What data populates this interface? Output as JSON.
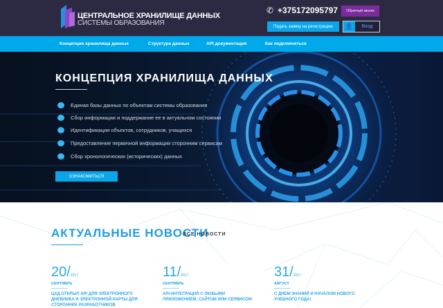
{
  "header": {
    "brand_title": "ЦЕНТРАЛЬНОЕ ХРАНИЛИЩЕ ДАННЫХ",
    "brand_subtitle": "СИСТЕМЫ ОБРАЗОВАНИЯ",
    "phone": "+375172095797",
    "callback": "Обратный звонок",
    "register": "Подать заявку на регистрацию",
    "login": "Вход"
  },
  "nav": [
    "Концепция хранилища данных",
    "Структура данных",
    "API документация",
    "Как подключиться"
  ],
  "hero": {
    "title": "КОНЦЕПЦИЯ ХРАНИЛИЩА ДАННЫХ",
    "items": [
      "Единая базы данных по объектам системы образования",
      "Сбор информации и поддержание ее в актуальном состоянии",
      "Идентификация объектов, сотрудников, учащихся",
      "Предоставление первичной информации сторонним сервисам",
      "Сбор хронологических (исторических) данных"
    ],
    "button": "ОЗНАКОМИТЬСЯ"
  },
  "news": {
    "title": "АКТУАЛЬНЫЕ НОВОСТИ",
    "all": "ВСЕ НОВОСТИ",
    "items": [
      {
        "day": "20/",
        "year": "2017",
        "month": "СЕНТЯБРЬ",
        "text": "ЦХД открыл API для электронного дневника и электронной карты для сторонних разработчиков"
      },
      {
        "day": "11/",
        "year": "2017",
        "month": "СЕНТЯБРЬ",
        "text": "API-интеграция с любыми приложением, сайтом или сервисом"
      },
      {
        "day": "31/",
        "year": "2017",
        "month": "АВГУСТ",
        "text": "С днем знаний и началом нового учебного года!"
      }
    ]
  }
}
